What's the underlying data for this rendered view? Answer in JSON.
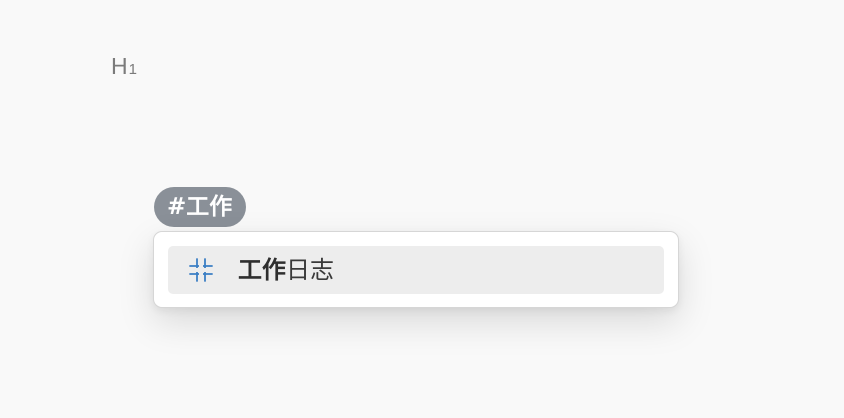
{
  "editor": {
    "heading_marker": {
      "letter": "H",
      "level": "1"
    }
  },
  "tag_input": {
    "hash": "#",
    "text": "工作"
  },
  "suggestions": {
    "items": [
      {
        "icon": "tag-slash-icon",
        "match": "工作",
        "rest": "日志"
      }
    ],
    "icon_color": "#3b7fc4",
    "chip_color": "#8a9098",
    "highlight_color": "#ededed"
  }
}
